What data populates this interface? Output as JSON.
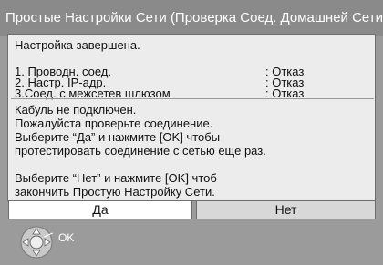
{
  "header": {
    "title": "Простые Настройки Сети  (Проверка Соед. Домашней Сети)"
  },
  "status": {
    "title": "Настройка завершена.",
    "steps": [
      {
        "label": "1. Проводн. соед.",
        "value": ": Отказ"
      },
      {
        "label": "2. Настр. IP-адр.",
        "value": ": Отказ"
      },
      {
        "label": "3.Соед. с межсетев шлюзом",
        "value": ": Отказ"
      }
    ]
  },
  "message": {
    "lines": [
      "Кабуль не подключен.",
      "Пожалуйста проверьте соединение.",
      "Выберите “Да” и нажмите [OK] чтобы",
      "протестировать соединение с сетью еще раз.",
      "",
      "Выберите “Нет” и нажмите [OK] чтоб",
      "закончить Простую Настройку Сети."
    ]
  },
  "buttons": {
    "yes": "Да",
    "no": "Нет"
  },
  "footer": {
    "ok_label": "OK",
    "icon": "dpad-icon"
  },
  "colors": {
    "background": "#9b9b9b",
    "panel": "#ececec",
    "selected_button": "#ffffff",
    "unselected_button": "#d8d8d8"
  }
}
